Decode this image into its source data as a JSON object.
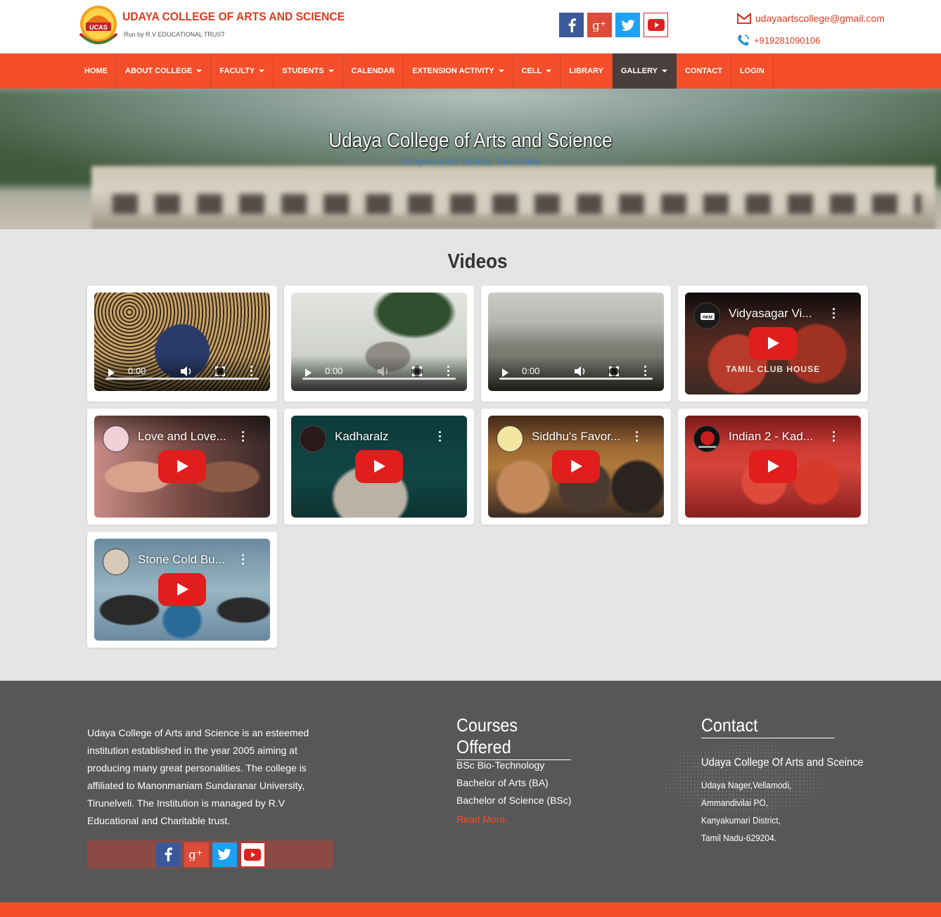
{
  "header": {
    "brand_title": "UDAYA COLLEGE OF ARTS AND SCIENCE",
    "brand_subtitle": "Run by R.V EDUCATIONAL TRUST",
    "logo_text": "UCAS",
    "email": "udayaartscollege@gmail.com",
    "phone": "+919281090106",
    "social": [
      "facebook-icon",
      "google-plus-icon",
      "twitter-icon",
      "youtube-icon"
    ]
  },
  "nav": {
    "items": [
      {
        "label": "HOME",
        "dropdown": false
      },
      {
        "label": "ABOUT COLLEGE",
        "dropdown": true
      },
      {
        "label": "FACULTY",
        "dropdown": true
      },
      {
        "label": "STUDENTS",
        "dropdown": true
      },
      {
        "label": "CALENDAR",
        "dropdown": false
      },
      {
        "label": "EXTENSION ACTIVITY",
        "dropdown": true
      },
      {
        "label": "CELL",
        "dropdown": true
      },
      {
        "label": "LIBRARY",
        "dropdown": false
      },
      {
        "label": "GALLERY",
        "dropdown": true,
        "active": true
      },
      {
        "label": "CONTACT",
        "dropdown": false
      },
      {
        "label": "LOGIN",
        "dropdown": false
      }
    ]
  },
  "hero": {
    "title": "Udaya College of Arts and Science",
    "subtitle": "Kanyakumari District, Tamilnadu"
  },
  "videos": {
    "heading": "Videos",
    "local": [
      {
        "time": "0:00"
      },
      {
        "time": "0:00"
      },
      {
        "time": "0:00"
      }
    ],
    "youtube": [
      {
        "title": "Vidyasagar Vi...",
        "caption": "TAMIL CLUB HOUSE"
      },
      {
        "title": "Love and Love..."
      },
      {
        "title": "Kadharalz"
      },
      {
        "title": "Siddhu's Favor..."
      },
      {
        "title": "Indian 2 - Kad..."
      },
      {
        "title": "Stone Cold Bu..."
      }
    ]
  },
  "footer": {
    "about": "Udaya College of Arts and Science is an esteemed institution established in the year 2005 aiming at producing many great personalities. The college is affiliated to Manonmaniam Sundaranar University, Tirunelveli. The Institution is managed by R.V Educational and Charitable trust.",
    "courses_title": "Courses Offered",
    "courses": [
      "BSc Bio-Technology",
      "Bachelor of Arts (BA)",
      "Bachelor of Science (BSc)"
    ],
    "read_more": "Read More..",
    "contact_title": "Contact",
    "contact_name": "Udaya College Of Arts and Sceince",
    "address": [
      "Udaya Nager,Vellamodi,",
      "Ammandivilai PO,",
      "Kanyakumari District,",
      "Tamil Nadu-629204."
    ]
  },
  "colors": {
    "accent": "#f44e2a",
    "nav_active": "#4a3f3c",
    "footer_bg": "#575757",
    "brand_red": "#e03a1e"
  }
}
